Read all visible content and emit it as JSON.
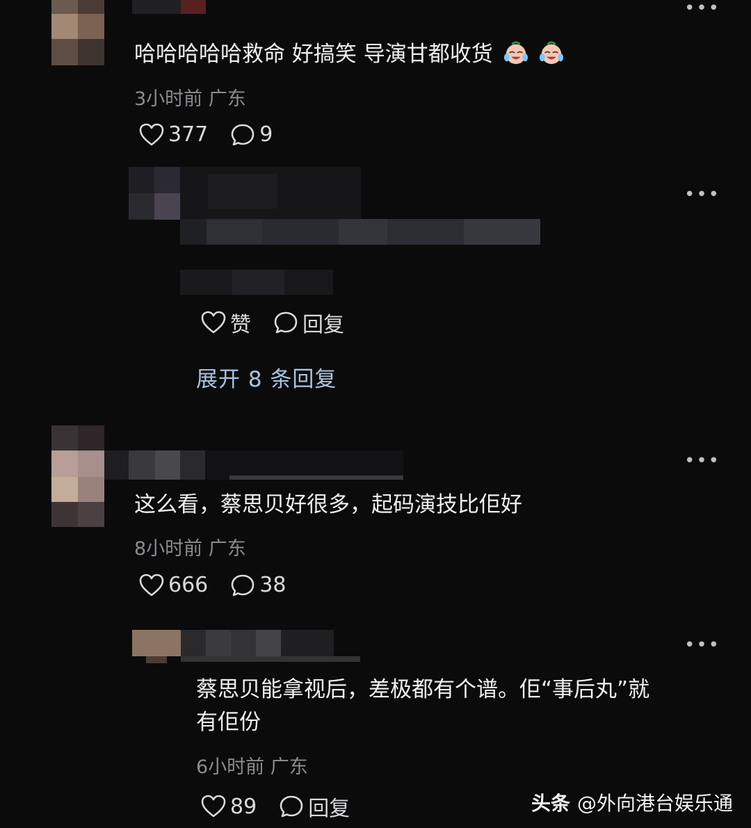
{
  "comments": [
    {
      "text": "哈哈哈哈哈救命 好搞笑 导演甘都收货",
      "emoji_icons": [
        "crying-laughing-face-icon",
        "crying-laughing-face-icon"
      ],
      "meta": "3小时前 广东",
      "likes": "377",
      "replies": "9",
      "reply": {
        "like_label": "赞",
        "reply_label": "回复"
      },
      "expand_label": "展开 8 条回复"
    },
    {
      "text": "这么看，蔡思贝好很多，起码演技比佢好",
      "meta": "8小时前 广东",
      "likes": "666",
      "replies": "38",
      "reply": {
        "text_line1": "蔡思贝能拿视后，差极都有个谱。佢“事后丸”就",
        "text_line2": "有佢份",
        "meta": "6小时前 广东",
        "likes": "89",
        "reply_label": "回复"
      }
    }
  ],
  "more_icon": "more-dots-icon",
  "watermark": {
    "brand": "头条",
    "account": "@外向港台娱乐通"
  }
}
